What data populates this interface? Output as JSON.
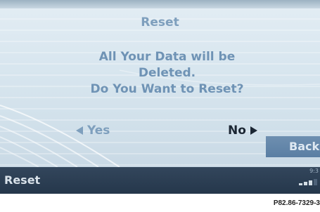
{
  "dialog": {
    "title": "Reset",
    "message_lines": [
      "All Your Data will be",
      "Deleted.",
      "Do You Want to Reset?"
    ],
    "yes_label": "Yes",
    "no_label": "No",
    "back_label": "Back"
  },
  "status_bar": {
    "label": "Reset",
    "clock": "9:3",
    "signal_bars": 3
  },
  "caption": "P82.86-7329-3",
  "colors": {
    "accent": "#6f93b5",
    "status_bar": "#2c3f54",
    "back_button": "#6485a9"
  }
}
